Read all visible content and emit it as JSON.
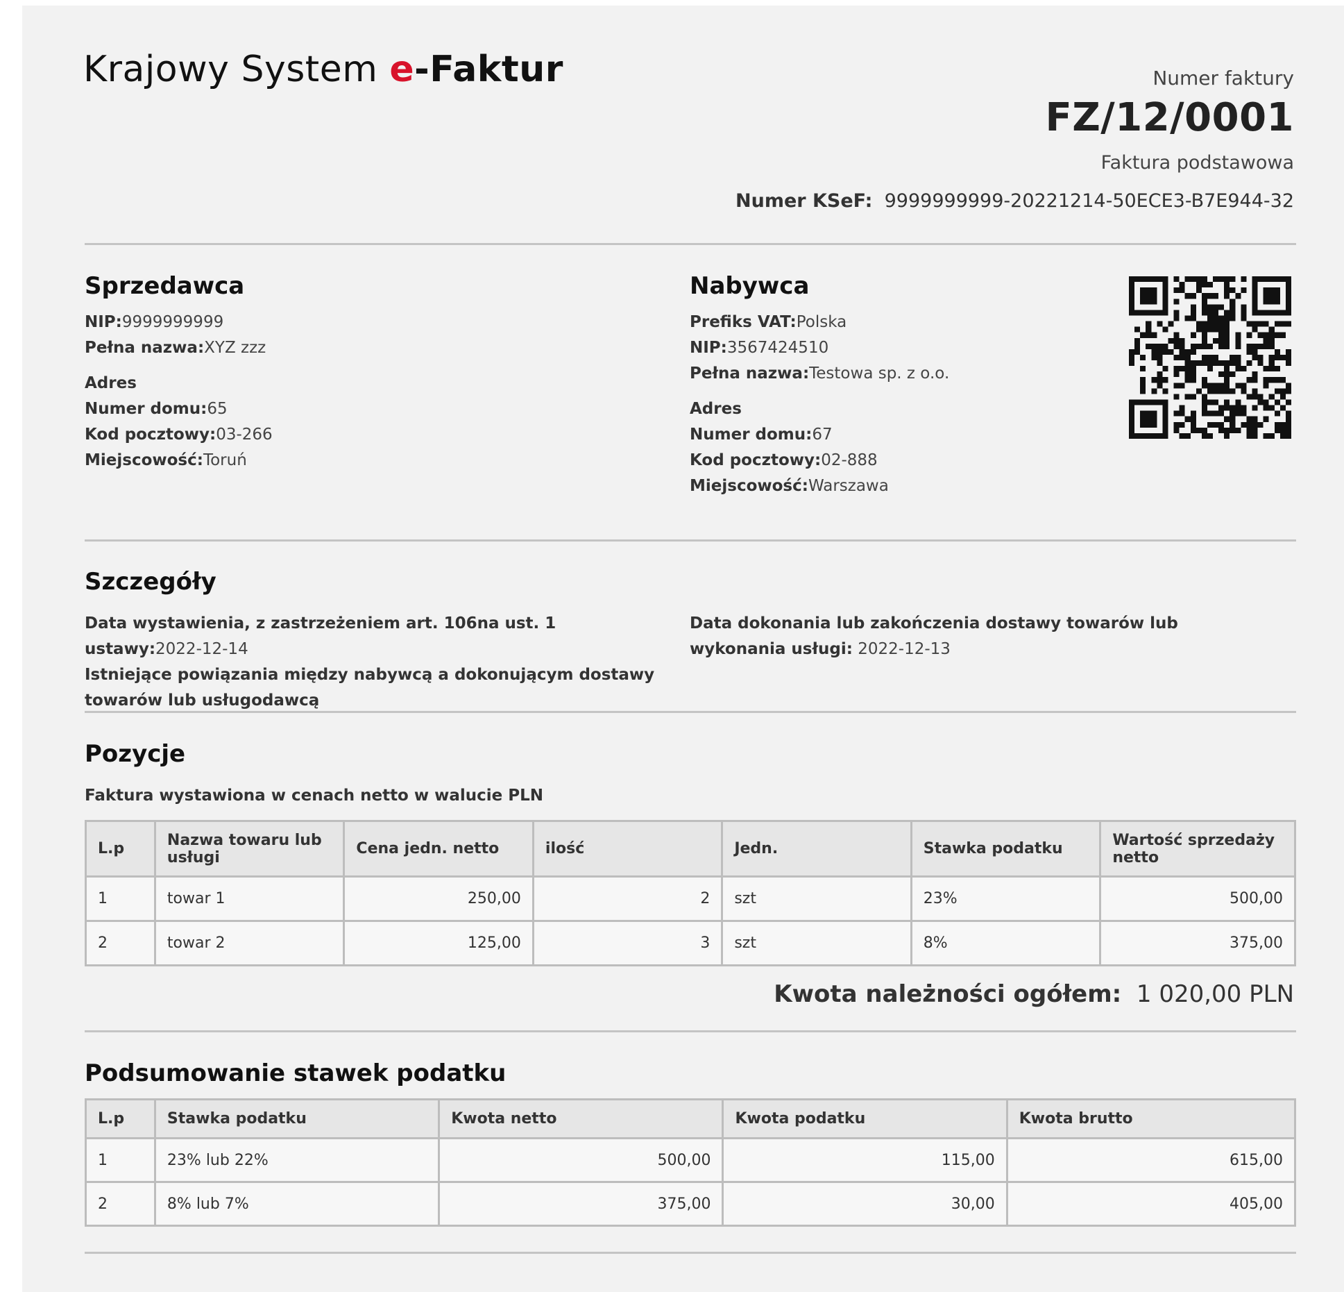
{
  "header": {
    "logo_prefix": "Krajowy System ",
    "logo_e": "e",
    "logo_suffix": "-Faktur",
    "number_label": "Numer faktury",
    "number_value": "FZ/12/0001",
    "invoice_type": "Faktura podstawowa",
    "ksef_label": "Numer KSeF:",
    "ksef_value": "9999999999-20221214-50ECE3-B7E944-32"
  },
  "seller": {
    "title": "Sprzedawca",
    "nip_label": "NIP:",
    "nip": "9999999999",
    "name_label": "Pełna nazwa:",
    "name": "XYZ zzz",
    "address_title": "Adres",
    "house_label": "Numer domu:",
    "house": "65",
    "postal_label": "Kod pocztowy:",
    "postal": "03-266",
    "city_label": "Miejscowość:",
    "city": "Toruń"
  },
  "buyer": {
    "title": "Nabywca",
    "vat_prefix_label": "Prefiks VAT:",
    "vat_prefix": "Polska",
    "nip_label": "NIP:",
    "nip": "3567424510",
    "name_label": "Pełna nazwa:",
    "name": "Testowa sp. z o.o.",
    "address_title": "Adres",
    "house_label": "Numer domu:",
    "house": "67",
    "postal_label": "Kod pocztowy:",
    "postal": "02-888",
    "city_label": "Miejscowość:",
    "city": "Warszawa"
  },
  "details": {
    "title": "Szczegóły",
    "issue_label": "Data wystawienia, z zastrzeżeniem art. 106na ust. 1 ustawy:",
    "issue_date": "2022-12-14",
    "relations": "Istniejące powiązania między nabywcą a dokonującym dostawy towarów lub usługodawcą",
    "delivery_label": "Data dokonania lub zakończenia dostawy towarów lub wykonania usługi:",
    "delivery_date": "2022-12-13"
  },
  "positions": {
    "title": "Pozycje",
    "note": "Faktura wystawiona w cenach netto w walucie PLN",
    "headers": [
      "L.p",
      "Nazwa towaru lub usługi",
      "Cena jedn. netto",
      "ilość",
      "Jedn.",
      "Stawka podatku",
      "Wartość sprzedaży netto"
    ],
    "rows": [
      [
        "1",
        "towar 1",
        "250,00",
        "2",
        "szt",
        "23%",
        "500,00"
      ],
      [
        "2",
        "towar 2",
        "125,00",
        "3",
        "szt",
        "8%",
        "375,00"
      ]
    ],
    "total_label": "Kwota należności ogółem:",
    "total_value": "1 020,00 PLN"
  },
  "tax_summary": {
    "title": "Podsumowanie stawek podatku",
    "headers": [
      "L.p",
      "Stawka podatku",
      "Kwota netto",
      "Kwota podatku",
      "Kwota brutto"
    ],
    "rows": [
      [
        "1",
        "23% lub 22%",
        "500,00",
        "115,00",
        "615,00"
      ],
      [
        "2",
        "8% lub 7%",
        "375,00",
        "30,00",
        "405,00"
      ]
    ]
  },
  "colors": {
    "brand_red": "#d8132b",
    "page_bg": "#f2f2f2",
    "rule": "#c4c4c4"
  },
  "icons": {
    "qr": "qr-code-icon"
  }
}
